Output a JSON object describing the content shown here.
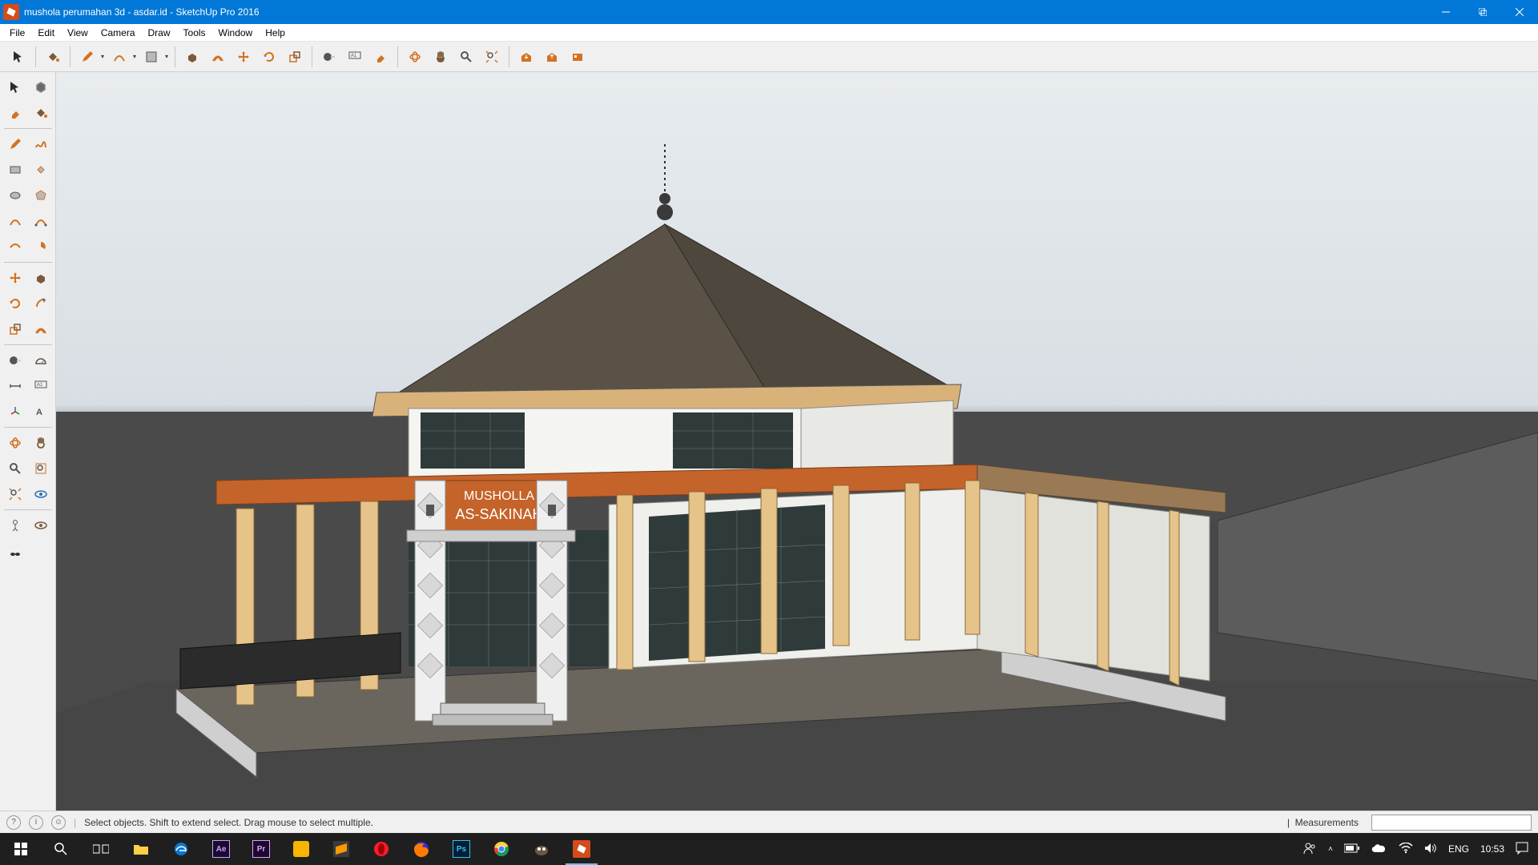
{
  "window": {
    "title": "mushola perumahan 3d - asdar.id - SketchUp Pro 2016"
  },
  "menu": [
    "File",
    "Edit",
    "View",
    "Camera",
    "Draw",
    "Tools",
    "Window",
    "Help"
  ],
  "top_toolbar": {
    "groups": [
      [
        "select",
        "paint-bucket",
        "pencil",
        "pencil-dd",
        "arc",
        "arc-dd",
        "shape",
        "shape-dd"
      ],
      [
        "push-pull",
        "offset",
        "move",
        "rotate",
        "scale"
      ],
      [
        "tape-measure",
        "text-a1",
        "eraser"
      ],
      [
        "zoom",
        "pan",
        "orbit",
        "zoom-extents"
      ],
      [
        "warehouse-get",
        "warehouse-share",
        "extension"
      ]
    ]
  },
  "left_toolbar_rows": [
    [
      "select",
      "component-make"
    ],
    [
      "eraser",
      "paint-bucket"
    ],
    "sep",
    [
      "pencil",
      "freehand"
    ],
    [
      "rectangle",
      "rotated-rect"
    ],
    [
      "circle",
      "polygon"
    ],
    [
      "arc",
      "arc2"
    ],
    [
      "arc3",
      "pie"
    ],
    "sep",
    [
      "move",
      "push-pull"
    ],
    [
      "rotate",
      "follow-me"
    ],
    [
      "scale",
      "offset"
    ],
    "sep",
    [
      "tape",
      "protractor"
    ],
    [
      "dimension",
      "text-a1"
    ],
    [
      "axes",
      "3dtext"
    ],
    "sep",
    [
      "orbit",
      "pan"
    ],
    [
      "zoom",
      "zoom-window"
    ],
    [
      "zoom-extents",
      "look-around"
    ],
    "sep",
    [
      "position-camera",
      "walk"
    ],
    [
      "section-plane",
      "spacer"
    ]
  ],
  "model": {
    "sign_line1": "MUSHOLLA",
    "sign_line2": "AS-SAKINAH"
  },
  "status": {
    "hint": "Select objects. Shift to extend select. Drag mouse to select multiple.",
    "measure_label": "Measurements",
    "measure_value": ""
  },
  "taskbar": {
    "apps": [
      "start",
      "search",
      "task-view",
      "explorer",
      "edge",
      "ae",
      "pr",
      "potplayer",
      "sublime",
      "opera",
      "firefox",
      "photoshop",
      "chrome",
      "gimp",
      "sketchup"
    ],
    "active": "sketchup",
    "tray": {
      "lang": "ENG",
      "clock": "10:53"
    }
  }
}
